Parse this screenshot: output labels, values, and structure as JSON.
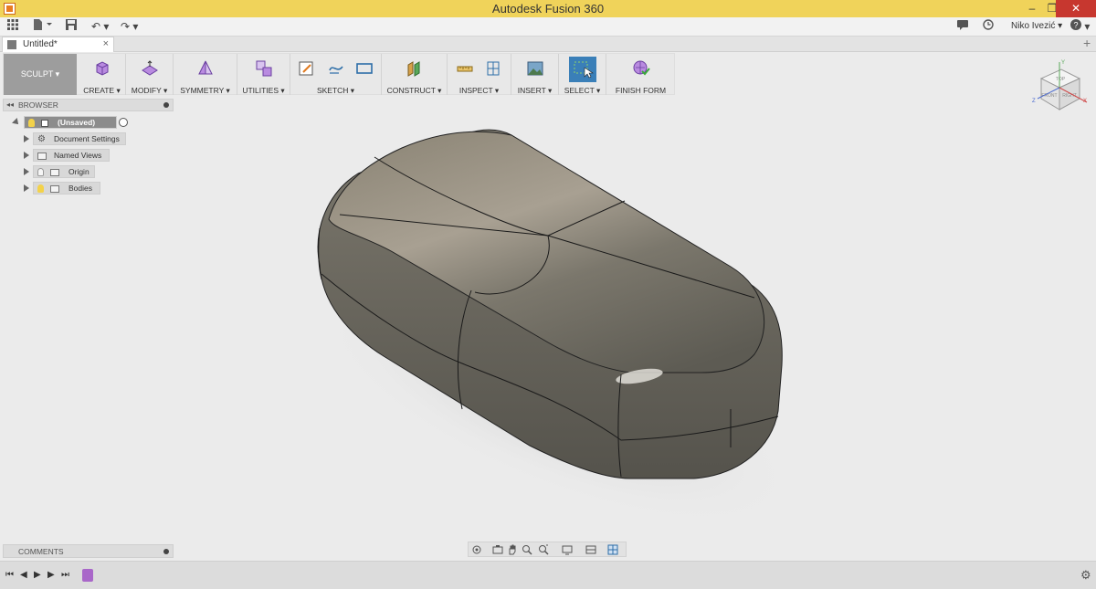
{
  "app": {
    "title": "Autodesk Fusion 360"
  },
  "window_controls": {
    "minimize": "–",
    "maximize": "❐",
    "close": "✕"
  },
  "quick_access": {
    "user_name": "Niko Ivezić",
    "undo_glyph": "↶",
    "redo_glyph": "↷",
    "help_glyph": "?"
  },
  "document_tab": {
    "label": "Untitled*",
    "close": "×",
    "new_tab": "+"
  },
  "toolbar": {
    "workspace": "SCULPT ▾",
    "groups": {
      "create": "CREATE ▾",
      "modify": "MODIFY ▾",
      "symmetry": "SYMMETRY ▾",
      "utilities": "UTILITIES ▾",
      "sketch": "SKETCH ▾",
      "construct": "CONSTRUCT ▾",
      "inspect": "INSPECT ▾",
      "insert": "INSERT ▾",
      "select": "SELECT ▾",
      "finish_form": "FINISH FORM"
    }
  },
  "browser": {
    "title": "BROWSER",
    "root": "(Unsaved)",
    "items": [
      {
        "label": "Document Settings",
        "icon": "gear-icon"
      },
      {
        "label": "Named Views",
        "icon": "folder-icon"
      },
      {
        "label": "Origin",
        "icon": "folder-icon"
      },
      {
        "label": "Bodies",
        "icon": "folder-icon"
      }
    ]
  },
  "comments": {
    "title": "COMMENTS"
  },
  "colors": {
    "title_bar": "#f0d35a",
    "close_button": "#c7372f",
    "form_purple": "#9b6fd0",
    "body_dark": "#6e6c62",
    "body_light": "#a8a092",
    "timeline_marker": "#a967c9"
  },
  "viewcube": {
    "top": "TOP",
    "front": "FRONT",
    "right": "RIGHT",
    "axis_x": "X",
    "axis_y": "Y",
    "axis_z": "Z"
  }
}
